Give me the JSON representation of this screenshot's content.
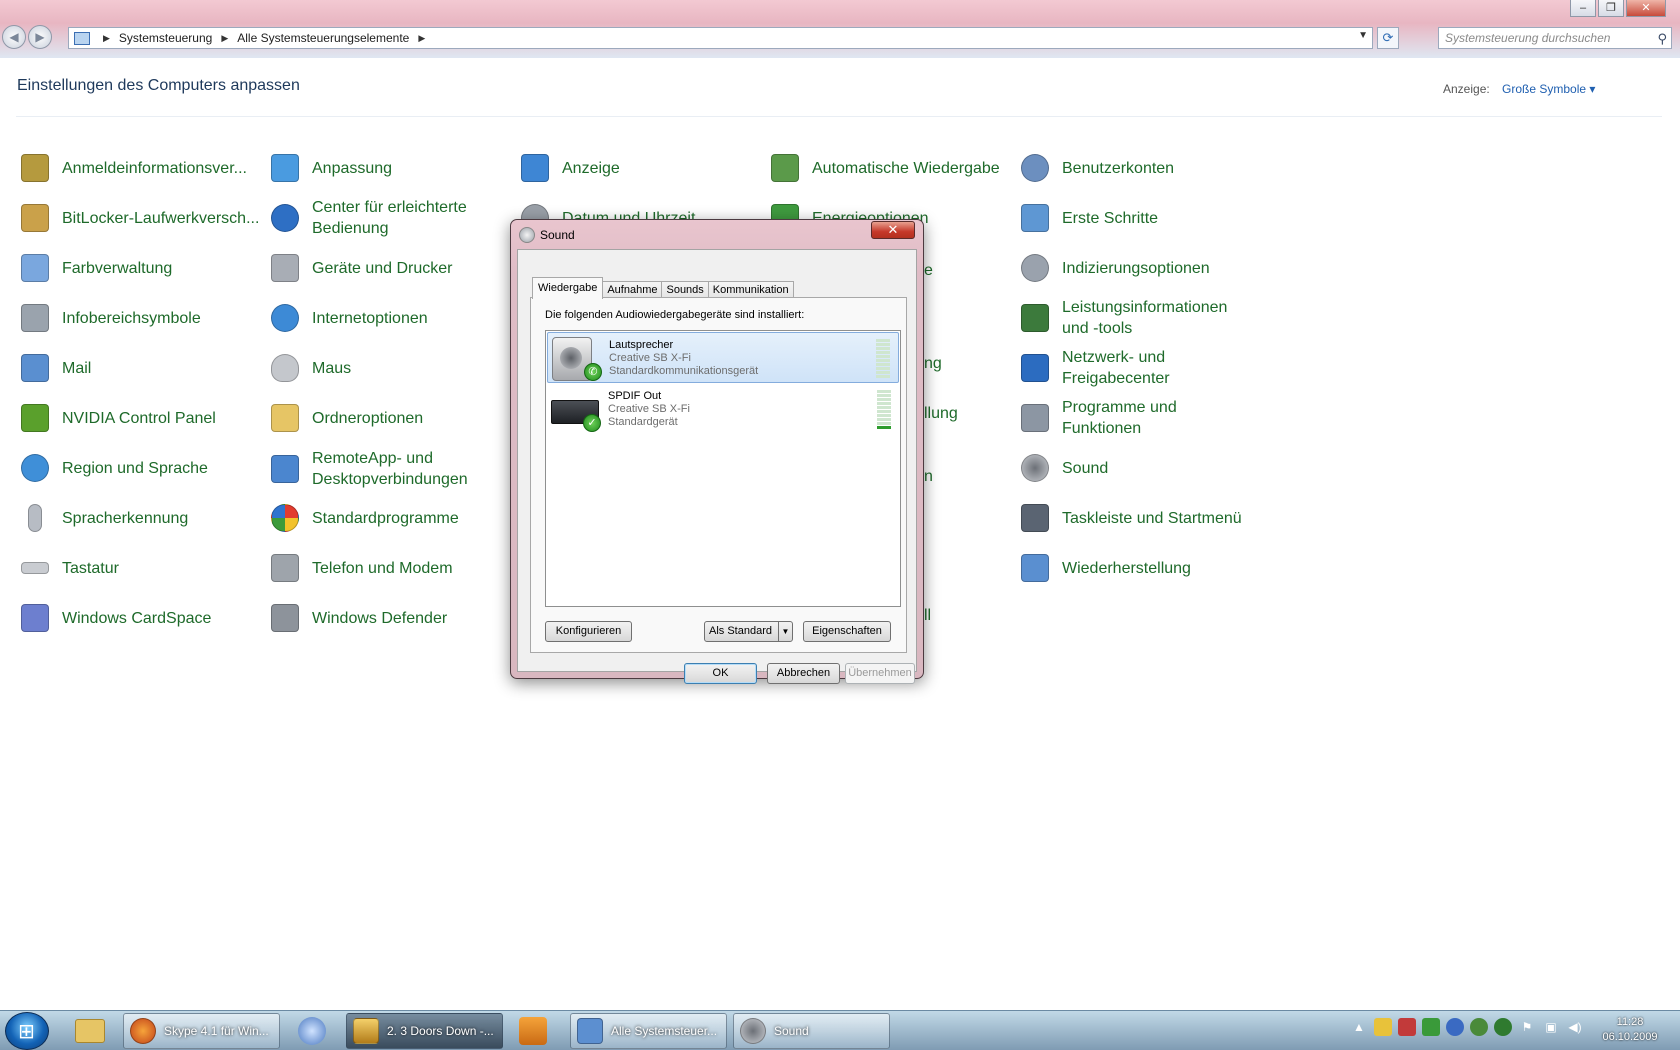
{
  "window": {
    "controls": {
      "minimize": "–",
      "maximize": "❐",
      "close": "✕"
    },
    "breadcrumb": [
      "Systemsteuerung",
      "Alle Systemsteuerungselemente"
    ],
    "search_placeholder": "Systemsteuerung durchsuchen"
  },
  "content": {
    "heading": "Einstellungen des Computers anpassen",
    "view_label": "Anzeige:",
    "view_value": "Große Symbole ▾",
    "columns": [
      [
        {
          "label": "Anmeldeinformationsver...",
          "icon": "vault-icon",
          "color": "#b59a3e"
        },
        {
          "label": "BitLocker-Laufwerkversch...",
          "icon": "key-icon",
          "color": "#caa14a"
        },
        {
          "label": "Farbverwaltung",
          "icon": "color-management-icon",
          "color": "#7aa7de"
        },
        {
          "label": "Infobereichsymbole",
          "icon": "notification-icons-icon",
          "color": "#9aa3ad"
        },
        {
          "label": "Mail",
          "icon": "mail-icon",
          "color": "#5a8fd0"
        },
        {
          "label": "NVIDIA Control Panel",
          "icon": "nvidia-icon",
          "color": "#5aa02c"
        },
        {
          "label": "Region und Sprache",
          "icon": "globe-icon",
          "color": "#3f8fd8"
        },
        {
          "label": "Spracherkennung",
          "icon": "microphone-icon",
          "color": "#b7bcc4"
        },
        {
          "label": "Tastatur",
          "icon": "keyboard-icon",
          "color": "#c9ccd1"
        },
        {
          "label": "Windows CardSpace",
          "icon": "cardspace-icon",
          "color": "#6d7fcf"
        }
      ],
      [
        {
          "label": "Anpassung",
          "icon": "personalization-icon",
          "color": "#4a9be0"
        },
        {
          "label": "Center für erleichterte\nBedienung",
          "icon": "ease-of-access-icon",
          "color": "#2e6fc4"
        },
        {
          "label": "Geräte und Drucker",
          "icon": "printer-icon",
          "color": "#a8adb5"
        },
        {
          "label": "Internetoptionen",
          "icon": "internet-options-icon",
          "color": "#3d8ad6"
        },
        {
          "label": "Maus",
          "icon": "mouse-icon",
          "color": "#c4c7cc"
        },
        {
          "label": "Ordneroptionen",
          "icon": "folder-icon",
          "color": "#e6c565"
        },
        {
          "label": "RemoteApp- und\nDesktopverbindungen",
          "icon": "remote-desktop-icon",
          "color": "#4b86cf"
        },
        {
          "label": "Standardprogramme",
          "icon": "default-programs-icon",
          "color": "#3c9b3a"
        },
        {
          "label": "Telefon und Modem",
          "icon": "phone-modem-icon",
          "color": "#9ea4ab"
        },
        {
          "label": "Windows Defender",
          "icon": "defender-icon",
          "color": "#8d939b"
        }
      ],
      [
        {
          "label": "Anzeige",
          "icon": "display-icon",
          "color": "#3e86d4"
        },
        {
          "label": "Datum und Uhrzeit",
          "icon": "clock-icon",
          "color": "#9aa0a8"
        }
      ],
      [
        {
          "label": "Automatische Wiedergabe",
          "icon": "autoplay-icon",
          "color": "#5b9a4a"
        },
        {
          "label": "Energieoptionen",
          "icon": "power-options-icon",
          "color": "#3f9b3f"
        }
      ],
      [
        {
          "label": "Benutzerkonten",
          "icon": "user-accounts-icon",
          "color": "#6c8fbf"
        },
        {
          "label": "Erste Schritte",
          "icon": "getting-started-icon",
          "color": "#5e97d3"
        },
        {
          "label": "Indizierungsoptionen",
          "icon": "indexing-icon",
          "color": "#9aa2ad"
        },
        {
          "label": "Leistungsinformationen\nund -tools",
          "icon": "performance-icon",
          "color": "#3c7a3c"
        },
        {
          "label": "Netzwerk- und\nFreigabecenter",
          "icon": "network-icon",
          "color": "#2c6cc0"
        },
        {
          "label": "Programme und\nFunktionen",
          "icon": "programs-icon",
          "color": "#8c96a3"
        },
        {
          "label": "Sound",
          "icon": "speaker-icon",
          "color": "#aeb2b8"
        },
        {
          "label": "Taskleiste und Startmenü",
          "icon": "taskbar-icon",
          "color": "#5a6472"
        },
        {
          "label": "Wiederherstellung",
          "icon": "recovery-icon",
          "color": "#5a8fd0"
        }
      ]
    ],
    "peek": [
      "ll",
      "ng",
      "n",
      "llung",
      "e"
    ]
  },
  "dialog": {
    "title": "Sound",
    "close": "✕",
    "tabs": [
      "Wiedergabe",
      "Aufnahme",
      "Sounds",
      "Kommunikation"
    ],
    "active_tab": "Wiedergabe",
    "instruction": "Die folgenden Audiowiedergabegeräte sind installiert:",
    "devices": [
      {
        "name": "Lautsprecher",
        "driver": "Creative SB X-Fi",
        "status": "Standardkommunikationsgerät",
        "badge": "✆",
        "selected": true,
        "level": 0
      },
      {
        "name": "SPDIF Out",
        "driver": "Creative SB X-Fi",
        "status": "Standardgerät",
        "badge": "✓",
        "selected": false,
        "level": 1
      }
    ],
    "buttons": {
      "configure": "Konfigurieren",
      "set_default": "Als Standard",
      "properties": "Eigenschaften",
      "ok": "OK",
      "cancel": "Abbrechen",
      "apply": "Übernehmen"
    }
  },
  "taskbar": {
    "items": [
      {
        "label": "Skype 4.1 für Win...",
        "icon": "firefox-icon",
        "color": "#e06a1f"
      },
      {
        "label": "2. 3 Doors Down -...",
        "icon": "winamp-icon",
        "color": "#d9a233"
      },
      {
        "label": "Alle Systemsteuer...",
        "icon": "control-panel-icon",
        "color": "#5c8fd0"
      },
      {
        "label": "Sound",
        "icon": "speaker-icon",
        "color": "#b7bbc1"
      }
    ],
    "clock_time": "11:28",
    "clock_date": "06.10.2009"
  }
}
